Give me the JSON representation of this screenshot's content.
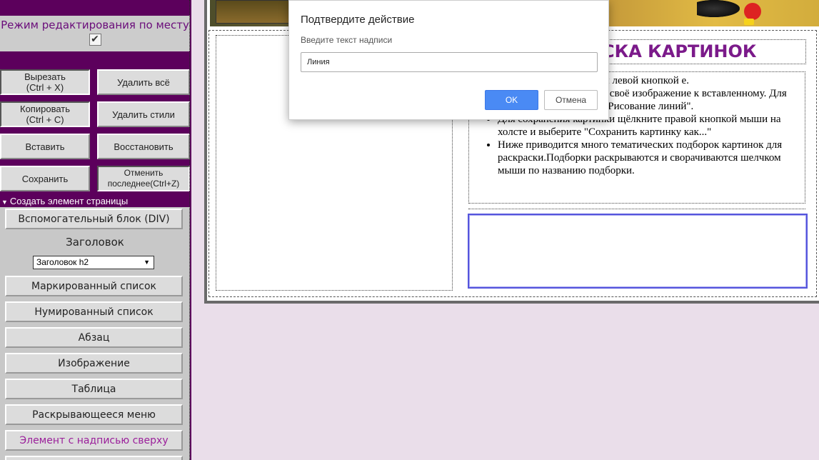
{
  "sidebar": {
    "edit_mode_label": "Режим редактирования по месту",
    "edit_mode_checked": "✔",
    "buttons": {
      "cut": "Вырезать\n(Ctrl + X)",
      "delete_all": "Удалить всё",
      "copy": "Копировать\n(Ctrl + C)",
      "delete_styles": "Удалить стили",
      "paste": "Вставить",
      "restore": "Восстановить",
      "save": "Сохранить",
      "undo": "Отменить\nпоследнее(Ctrl+Z)"
    },
    "section_header": "Создать элемент страницы",
    "create": {
      "div": "Вспомогательный блок (DIV)",
      "heading_label": "Заголовок",
      "heading_select": "Заголовок h2",
      "bullet_list": "Маркированный список",
      "numbered_list": "Нумированный список",
      "paragraph": "Абзац",
      "image": "Изображение",
      "table": "Таблица",
      "dropdown_menu": "Раскрывающееся меню",
      "labeled_element": "Элемент с надписью сверху"
    }
  },
  "page": {
    "heading": "СКА КАРТИНОК",
    "list_items": [
      "тинку на фоне страницы левой кнопкой е.",
      "й рисунок или добавить своё изображение к вставленному. Для этого включите режим \"Рисование линий\".",
      "Для сохранения картинки щёлкните правой кнопкой мыши на холсте и выберите \"Сохранить картинку как...\"",
      "Ниже приводится много тематических подборок картинок для раскраски.Подборки раскрываются и сворачиваются шелчком мыши по названию подборки."
    ]
  },
  "modal": {
    "title": "Подтвердите действие",
    "message": "Введите текст надписи",
    "input_value": "Линия",
    "ok_label": "OK",
    "cancel_label": "Отмена"
  },
  "colors": {
    "sidebar_bg": "#5c005c",
    "heading_color": "#7b1a8a",
    "ok_button": "#4a8af4",
    "page_bg": "#eadeea"
  }
}
